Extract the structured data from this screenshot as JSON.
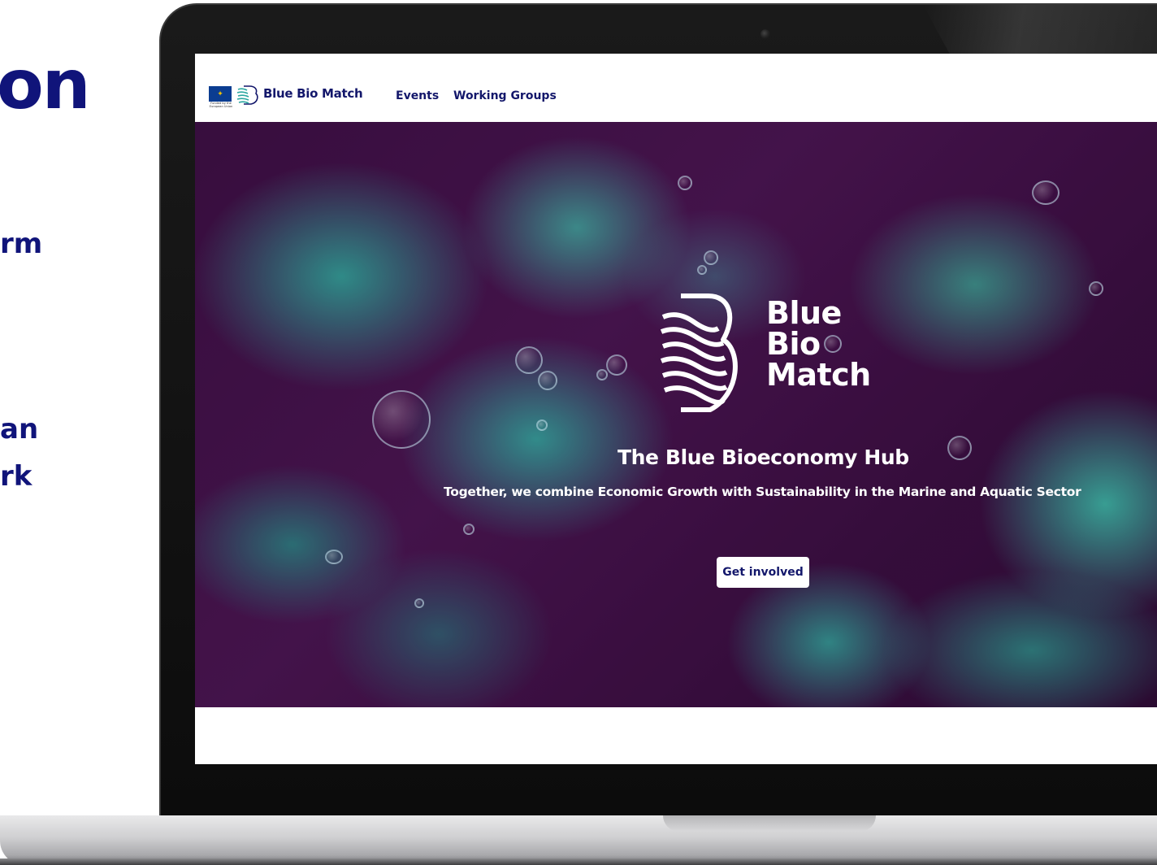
{
  "slide": {
    "title_fragment": "on",
    "line1_fragment": "rm",
    "line2_fragment": "an",
    "line3_fragment": "rk"
  },
  "nav": {
    "eu_caption": "Funded by the European Union",
    "brand": "Blue Bio Match",
    "links": [
      "Events",
      "Working Groups"
    ]
  },
  "hero": {
    "logo_lines": [
      "Blue",
      "Bio",
      "Match"
    ],
    "title": "The Blue Bioeconomy Hub",
    "subtitle": "Together, we combine Economic Growth with Sustainability in the Marine and Aquatic Sector",
    "cta": "Get involved"
  },
  "colors": {
    "brand_navy": "#13176b",
    "hero_purple": "#3b1042",
    "hero_teal": "#30b0a0"
  }
}
